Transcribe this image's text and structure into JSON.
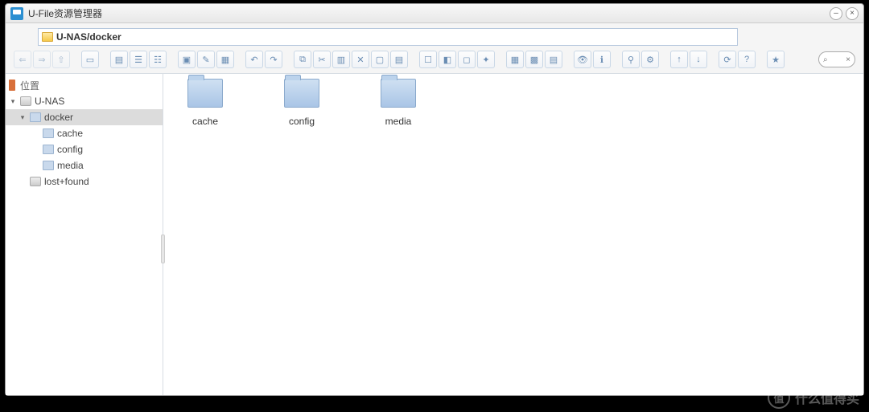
{
  "window": {
    "title": "U-File资源管理器",
    "minimize": "–",
    "close": "×"
  },
  "path": "U-NAS/docker",
  "sidebar": {
    "header": "位置",
    "tree": [
      {
        "label": "U-NAS",
        "depth": 0,
        "expanded": true,
        "icon": "disk",
        "selected": false
      },
      {
        "label": "docker",
        "depth": 1,
        "expanded": true,
        "icon": "folder",
        "selected": true
      },
      {
        "label": "cache",
        "depth": 2,
        "expanded": false,
        "icon": "folder",
        "selected": false
      },
      {
        "label": "config",
        "depth": 2,
        "expanded": false,
        "icon": "folder",
        "selected": false
      },
      {
        "label": "media",
        "depth": 2,
        "expanded": false,
        "icon": "folder",
        "selected": false
      },
      {
        "label": "lost+found",
        "depth": 1,
        "expanded": false,
        "icon": "disk",
        "selected": false
      }
    ]
  },
  "folders": [
    {
      "name": "cache"
    },
    {
      "name": "config"
    },
    {
      "name": "media"
    }
  ],
  "toolbar_groups": [
    [
      "back",
      "forward",
      "up"
    ],
    [
      "window"
    ],
    [
      "view-detail",
      "view-list",
      "view-tree"
    ],
    [
      "new-folder",
      "save",
      "archive"
    ],
    [
      "undo",
      "redo"
    ],
    [
      "copy",
      "cut",
      "paste",
      "delete",
      "rename",
      "clipboard"
    ],
    [
      "select-all",
      "select-invert",
      "select-none",
      "select-filter"
    ],
    [
      "grid-large",
      "grid-small",
      "grid-tiles"
    ],
    [
      "preview",
      "info"
    ],
    [
      "share",
      "permissions"
    ],
    [
      "sort-asc",
      "sort-desc"
    ],
    [
      "refresh",
      "help"
    ],
    [
      "bookmark"
    ]
  ],
  "toolbar_glyphs": {
    "back": "⇐",
    "forward": "⇒",
    "up": "⇧",
    "window": "▭",
    "view-detail": "▤",
    "view-list": "☰",
    "view-tree": "☷",
    "new-folder": "▣",
    "save": "✎",
    "archive": "▦",
    "undo": "↶",
    "redo": "↷",
    "copy": "⧉",
    "cut": "✂",
    "paste": "▥",
    "delete": "✕",
    "rename": "▢",
    "clipboard": "▤",
    "select-all": "☐",
    "select-invert": "◧",
    "select-none": "◻",
    "select-filter": "✦",
    "grid-large": "▦",
    "grid-small": "▩",
    "grid-tiles": "▤",
    "preview": "👁",
    "info": "ℹ",
    "share": "⚲",
    "permissions": "⚙",
    "sort-asc": "↑",
    "sort-desc": "↓",
    "refresh": "⟳",
    "help": "?",
    "bookmark": "★"
  },
  "search": {
    "icon": "⌕",
    "close": "×"
  },
  "watermark": {
    "badge": "值",
    "text": "什么值得买"
  }
}
